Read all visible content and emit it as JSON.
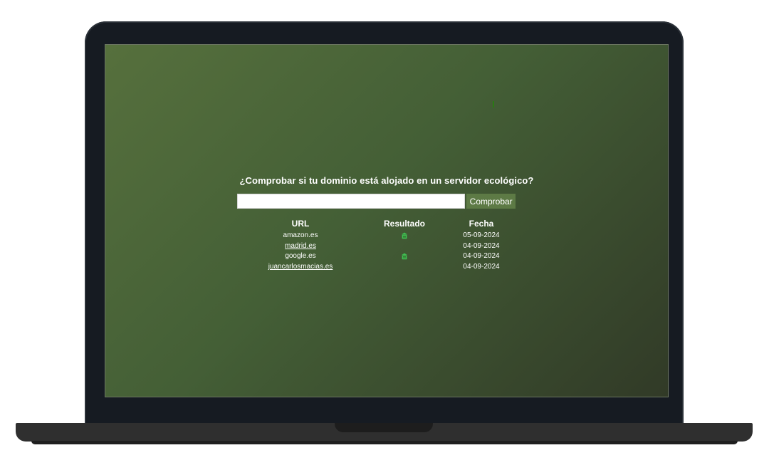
{
  "page": {
    "heading": "¿Comprobar si tu dominio está alojado en un servidor ecológico?"
  },
  "search": {
    "value": "",
    "placeholder": "",
    "button_label": "Comprobar"
  },
  "table": {
    "headers": {
      "url": "URL",
      "result": "Resultado",
      "date": "Fecha"
    },
    "rows": [
      {
        "url": "amazon.es",
        "linked": false,
        "green": true,
        "date": "05-09-2024"
      },
      {
        "url": "madrid.es",
        "linked": true,
        "green": false,
        "date": "04-09-2024"
      },
      {
        "url": "google.es",
        "linked": false,
        "green": true,
        "date": "04-09-2024"
      },
      {
        "url": "juancarlosmacias.es",
        "linked": true,
        "green": false,
        "date": "04-09-2024"
      }
    ],
    "green_icon": "green-server-icon"
  },
  "colors": {
    "background_start": "#56703d",
    "background_end": "#313a27",
    "button": "#5d7a45",
    "green_icon": "#3fbf52"
  }
}
